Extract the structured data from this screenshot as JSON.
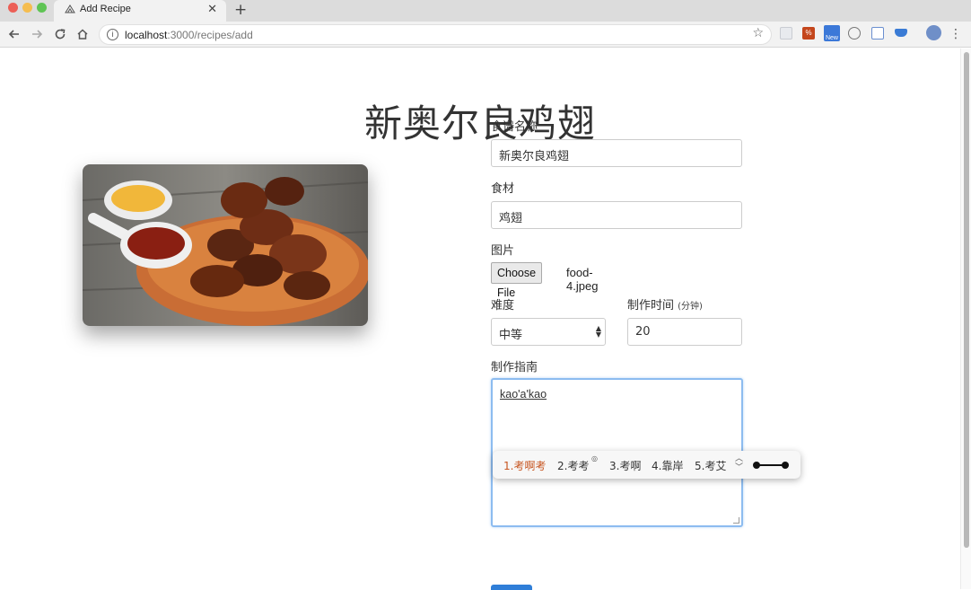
{
  "browser": {
    "tab_title": "Add Recipe",
    "tab_close": "✕",
    "new_tab": "+",
    "url_host": "localhost",
    "url_path": ":3000/recipes/add",
    "extensions": [
      "ext-grid",
      "ext-percent",
      "ext-new",
      "ext-globe",
      "ext-doc",
      "ext-cap",
      "ext-avatar"
    ],
    "extension_badge": "New"
  },
  "page": {
    "title": "新奥尔良鸡翅",
    "photo_alt": "food-4"
  },
  "form": {
    "name_label": "食谱名称",
    "name_value": "新奥尔良鸡翅",
    "ingredients_label": "食材",
    "ingredients_value": "鸡翅",
    "image_label": "图片",
    "choose_file": "Choose File",
    "file_name": "food-4.jpeg",
    "difficulty_label": "难度",
    "difficulty_value": "中等",
    "time_label": "制作时间",
    "time_unit": "(分钟)",
    "time_value": "20",
    "instructions_label": "制作指南",
    "instructions_value": "kao'a'kao"
  },
  "ime": {
    "candidates": [
      "1.考啊考",
      "2.考考",
      "3.考啊",
      "4.靠岸",
      "5.考艾"
    ],
    "selected_index": 0
  },
  "colors": {
    "accent": "#2f7ed8",
    "focus_border": "#8dbcf0",
    "ime_selected": "#c7541f"
  }
}
